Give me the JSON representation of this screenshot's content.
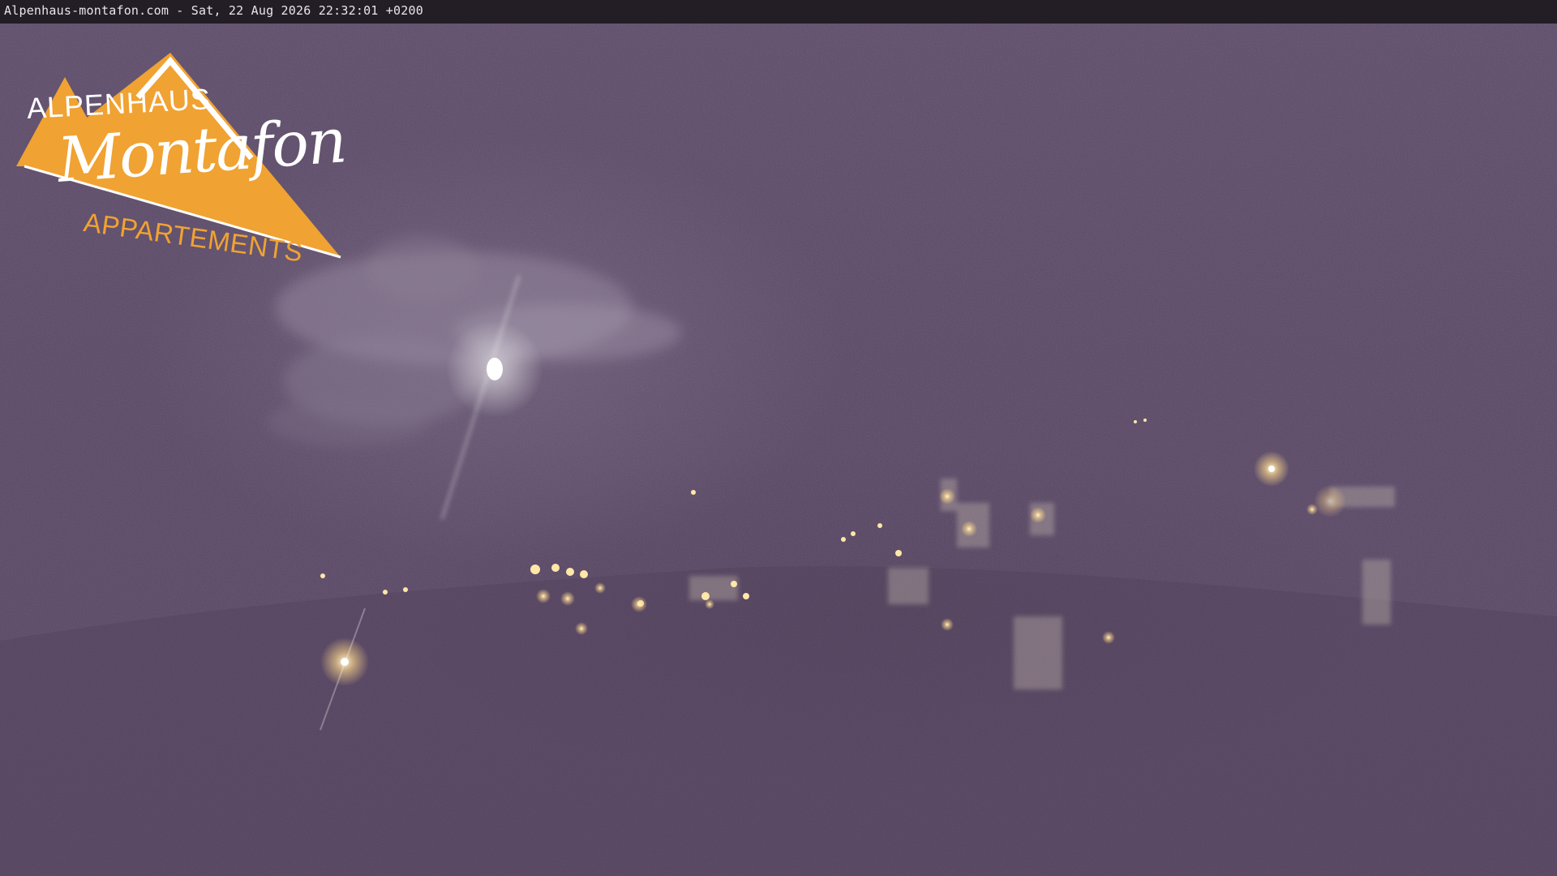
{
  "overlay": {
    "timestamp": "Alpenhaus-montafon.com - Sat, 22 Aug 2026 22:32:01 +0200"
  },
  "logo": {
    "line1": "ALPENHAUS",
    "line2": "Montafon",
    "line3": "APPARTEMENTS",
    "color": "#f0a232"
  },
  "colors": {
    "sky": "#5a4866",
    "bar": "#231d26",
    "light": "#fff1c8"
  }
}
